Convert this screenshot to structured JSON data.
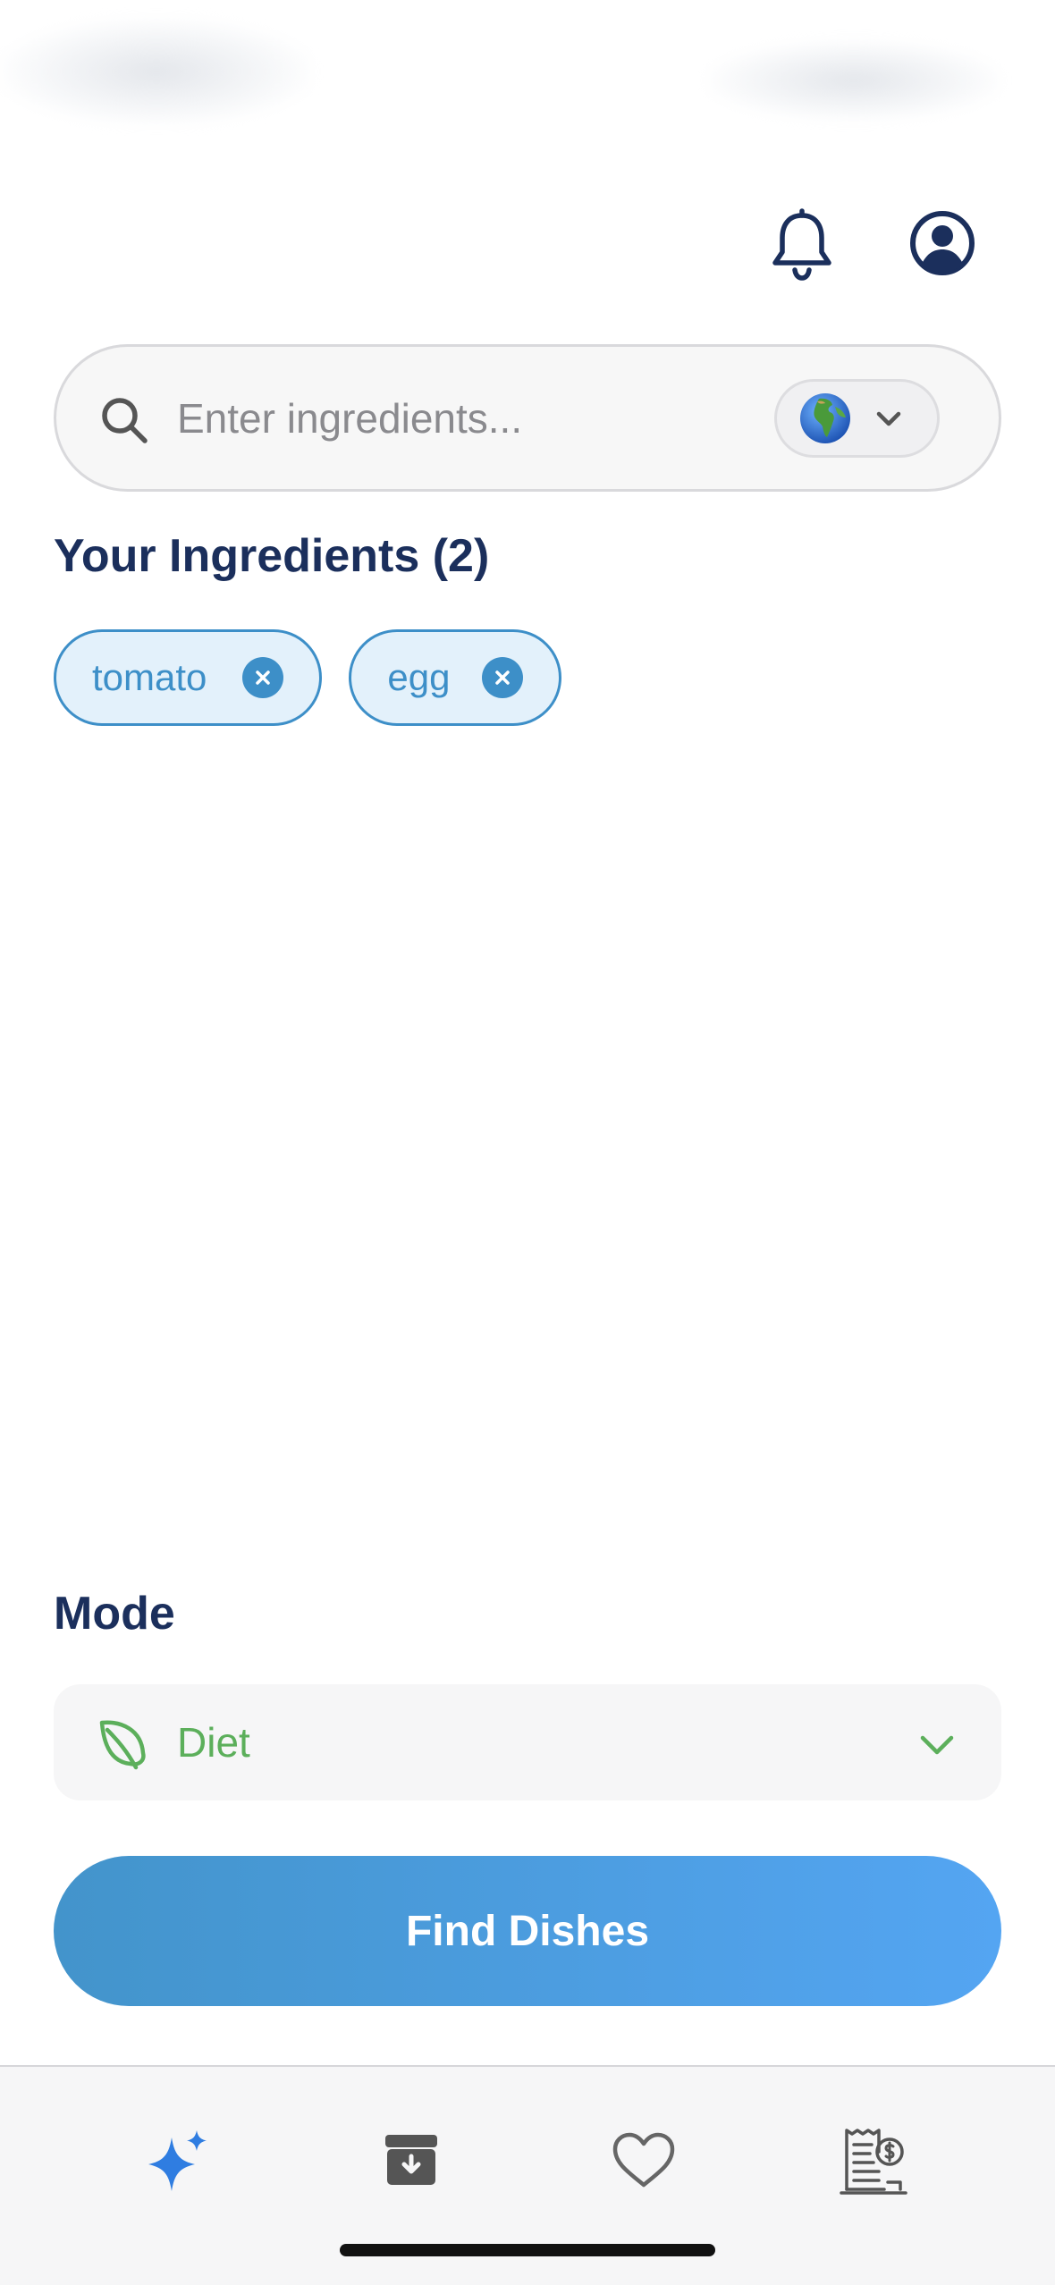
{
  "header": {
    "bell_icon": "bell-icon",
    "profile_icon": "user-circle-icon"
  },
  "search": {
    "placeholder": "Enter ingredients...",
    "value": "",
    "language_icon": "globe-emoji-icon"
  },
  "ingredients": {
    "title": "Your Ingredients (2)",
    "items": [
      {
        "label": "tomato"
      },
      {
        "label": "egg"
      }
    ]
  },
  "mode": {
    "title": "Mode",
    "selected": "Diet",
    "icon": "leaf-icon"
  },
  "actions": {
    "find_label": "Find Dishes"
  },
  "tab_bar": {
    "items": [
      {
        "icon": "sparkles-icon",
        "active": true
      },
      {
        "icon": "archive-box-icon",
        "active": false
      },
      {
        "icon": "heart-icon",
        "active": false
      },
      {
        "icon": "receipt-dollar-icon",
        "active": false
      }
    ]
  },
  "colors": {
    "primary_navy": "#1b2f5c",
    "chip_blue": "#3d8fc8",
    "diet_green": "#5caf5b",
    "button_gradient_start": "#4394cb",
    "button_gradient_end": "#54a5f2",
    "active_tab": "#2f7de1"
  }
}
